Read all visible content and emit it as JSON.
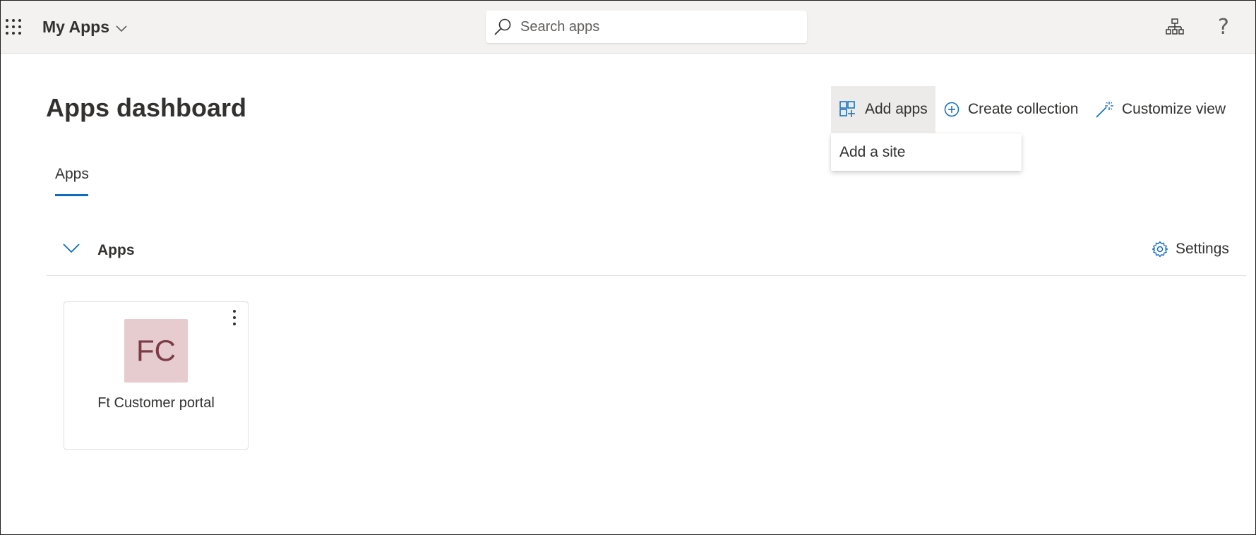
{
  "topbar": {
    "app_title": "My Apps",
    "search_placeholder": "Search apps",
    "help_glyph": "?"
  },
  "header": {
    "title": "Apps dashboard",
    "commands": {
      "add_apps": "Add apps",
      "create_collection": "Create collection",
      "customize_view": "Customize view"
    },
    "add_apps_menu": {
      "items": [
        "Add a site"
      ]
    }
  },
  "tabs": [
    {
      "label": "Apps",
      "selected": true
    }
  ],
  "section": {
    "title": "Apps",
    "settings_label": "Settings",
    "expanded": true
  },
  "apps": [
    {
      "initials": "FC",
      "name": "Ft Customer portal",
      "logo_bg": "#e6cbcf",
      "logo_fg": "#7b3c47"
    }
  ],
  "colors": {
    "accent": "#0f6cbd",
    "topbar_bg": "#f3f2f1",
    "text": "#323130"
  },
  "icons": {
    "launcher": "waffle-icon",
    "title_dropdown": "chevron-down-icon",
    "search": "search-icon",
    "org": "org-chart-icon",
    "help": "question-icon",
    "add_apps": "grid-add-icon",
    "create_collection": "add-circle-icon",
    "customize_view": "magic-wand-icon",
    "section_toggle": "chevron-down-icon",
    "settings": "gear-icon",
    "tile_more": "more-vertical-icon"
  }
}
